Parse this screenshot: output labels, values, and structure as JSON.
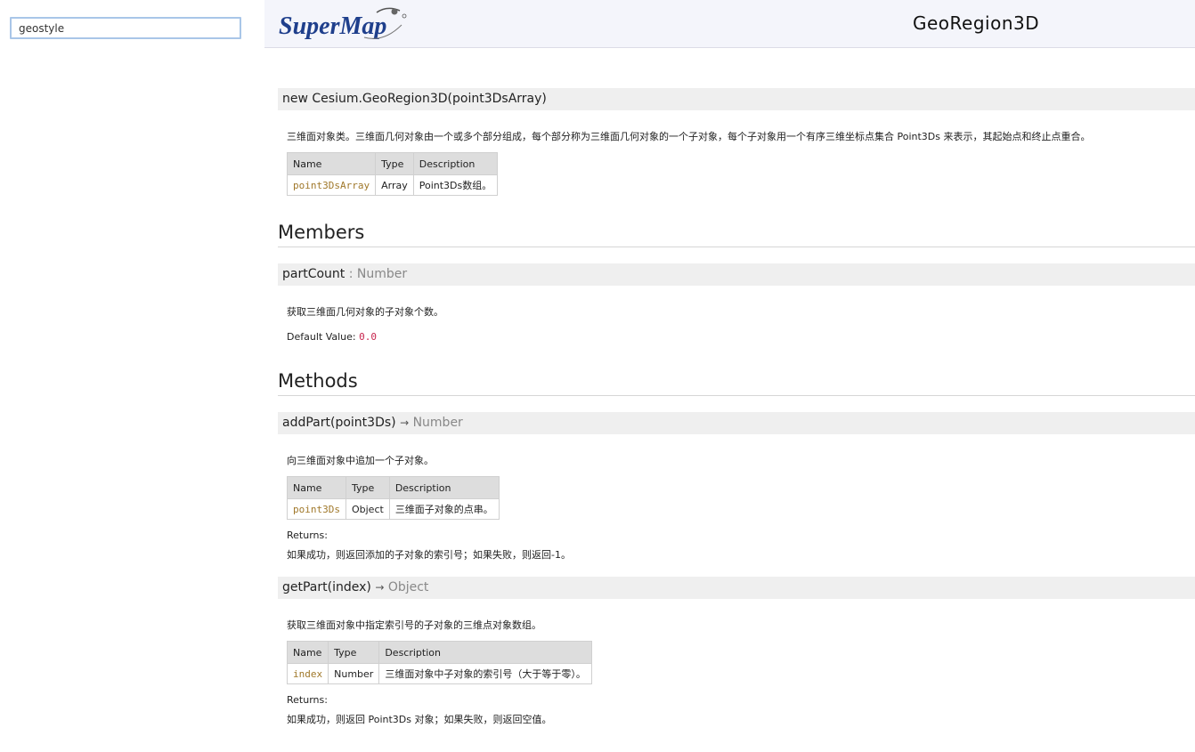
{
  "sidebar": {
    "search_value": "geostyle"
  },
  "header": {
    "logo_text": "SuperMap",
    "title": "GeoRegion3D"
  },
  "constructor": {
    "signature": "new Cesium.GeoRegion3D(point3DsArray)",
    "description": "三维面对象类。三维面几何对象由一个或多个部分组成，每个部分称为三维面几何对象的一个子对象，每个子对象用一个有序三维坐标点集合 Point3Ds 来表示，其起始点和终止点重合。",
    "params_headers": [
      "Name",
      "Type",
      "Description"
    ],
    "params": [
      {
        "name": "point3DsArray",
        "type": "Array",
        "description": "Point3Ds数组。"
      }
    ]
  },
  "members": {
    "title": "Members",
    "items": [
      {
        "name": "partCount",
        "type_sep": " : ",
        "type": "Number",
        "description": "获取三维面几何对象的子对象个数。",
        "default_label": "Default Value: ",
        "default_value": "0.0"
      }
    ]
  },
  "methods": {
    "title": "Methods",
    "items": [
      {
        "signature": "addPart(point3Ds)",
        "arrow": "→",
        "returns_type": "Number",
        "description": "向三维面对象中追加一个子对象。",
        "params_headers": [
          "Name",
          "Type",
          "Description"
        ],
        "params": [
          {
            "name": "point3Ds",
            "type": "Object",
            "description": "三维面子对象的点串。"
          }
        ],
        "returns_label": "Returns:",
        "returns_text": "如果成功，则返回添加的子对象的索引号；如果失败，则返回-1。"
      },
      {
        "signature": "getPart(index)",
        "arrow": "→",
        "returns_type": "Object",
        "description": "获取三维面对象中指定索引号的子对象的三维点对象数组。",
        "params_headers": [
          "Name",
          "Type",
          "Description"
        ],
        "params": [
          {
            "name": "index",
            "type": "Number",
            "description": "三维面对象中子对象的索引号（大于等于零）。"
          }
        ],
        "returns_label": "Returns:",
        "returns_text": "如果成功，则返回 Point3Ds 对象；如果失败，则返回空值。"
      }
    ]
  }
}
